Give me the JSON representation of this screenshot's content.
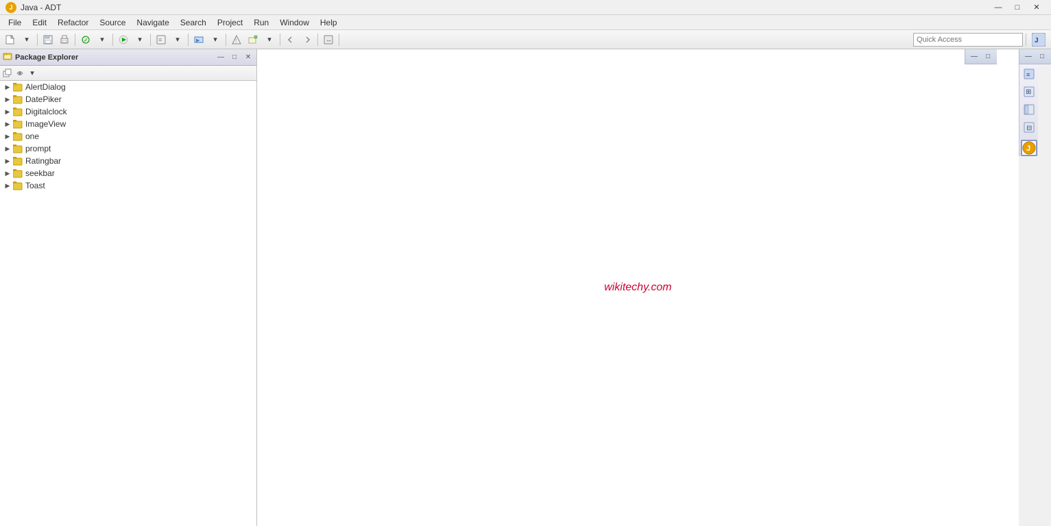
{
  "titleBar": {
    "title": "Java - ADT",
    "iconLabel": "J",
    "minimizeLabel": "—",
    "maximizeLabel": "□",
    "closeLabel": "✕"
  },
  "menuBar": {
    "items": [
      {
        "label": "File"
      },
      {
        "label": "Edit"
      },
      {
        "label": "Refactor"
      },
      {
        "label": "Source"
      },
      {
        "label": "Navigate"
      },
      {
        "label": "Search"
      },
      {
        "label": "Project"
      },
      {
        "label": "Run"
      },
      {
        "label": "Window"
      },
      {
        "label": "Help"
      }
    ]
  },
  "toolbar": {
    "quickAccess": {
      "placeholder": "Quick Access",
      "value": ""
    }
  },
  "packageExplorer": {
    "title": "Package Explorer",
    "closeLabel": "✕",
    "projects": [
      {
        "name": "AlertDialog"
      },
      {
        "name": "DatePiker"
      },
      {
        "name": "Digitalclock"
      },
      {
        "name": "ImageView"
      },
      {
        "name": "one"
      },
      {
        "name": "prompt"
      },
      {
        "name": "Ratingbar"
      },
      {
        "name": "seekbar"
      },
      {
        "name": "Toast"
      }
    ]
  },
  "editor": {
    "watermark": "wikitechy.com"
  },
  "rightSidebar": {
    "buttons": [
      {
        "icon": "≡",
        "label": "menu-icon"
      },
      {
        "icon": "⊞",
        "label": "grid-icon"
      },
      {
        "icon": "◫",
        "label": "panel-icon"
      },
      {
        "icon": "⊟",
        "label": "minus-icon"
      }
    ]
  },
  "perspective": {
    "javaPerspectiveLabel": "Java",
    "buttons": [
      {
        "label": "J",
        "active": true,
        "name": "java-perspective"
      },
      {
        "label": "⚙",
        "active": false,
        "name": "debug-perspective"
      }
    ]
  }
}
